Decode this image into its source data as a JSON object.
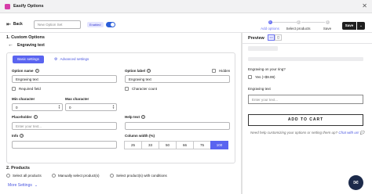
{
  "window": {
    "title": "Easify Options",
    "close_icon": "close-icon"
  },
  "toolbar": {
    "back_label": "Back",
    "set_name_placeholder": "New Option Set",
    "status_badge": "Enabled",
    "save_label": "Save"
  },
  "stepper": {
    "steps": [
      {
        "number": "1",
        "label": "Add options"
      },
      {
        "number": "2",
        "label": "Select products"
      },
      {
        "number": "3",
        "label": "Save"
      }
    ],
    "active_step": 1
  },
  "left": {
    "section1_title": "1. Custom Options",
    "option_type": "Engraving text",
    "tabs": {
      "basic": "Basic settings",
      "advanced": "Advanced settings"
    },
    "fields": {
      "option_name_label": "Option name",
      "option_name_value": "Engraving text",
      "option_label_label": "Option label",
      "option_label_value": "Engraving text",
      "hidden_label": "Hidden",
      "required_label": "Required field",
      "char_count_label": "Character count",
      "min_char_label": "Min character",
      "min_char_value": "0",
      "max_char_label": "Max character",
      "max_char_value": "0",
      "placeholder_label": "Placeholder",
      "placeholder_placeholder": "Enter your text...",
      "help_text_label": "Help text",
      "info_label": "Info",
      "column_width_label": "Column width (%)",
      "column_widths": [
        "25",
        "33",
        "50",
        "66",
        "75",
        "100"
      ],
      "selected_width": "100"
    },
    "section2_title": "2. Products",
    "product_options": [
      "Select all products",
      "Manually select product(s)",
      "Select product(s) with conditions"
    ],
    "more_settings": "More Settings"
  },
  "preview": {
    "title": "Preview",
    "question": "Engraving on your ring?",
    "yes_option": "Yes (+$9.99)",
    "engraving_label": "Engraving text",
    "engraving_placeholder": "Enter your text...",
    "add_to_cart": "ADD TO CART",
    "help_prefix": "Need help customizing your options or setting them up?",
    "help_link": "Chat with us!"
  },
  "colors": {
    "accent": "#5a64f0",
    "dark": "#1f1f1f",
    "chat": "#1c2a4a",
    "logo": "#d63ca8"
  }
}
